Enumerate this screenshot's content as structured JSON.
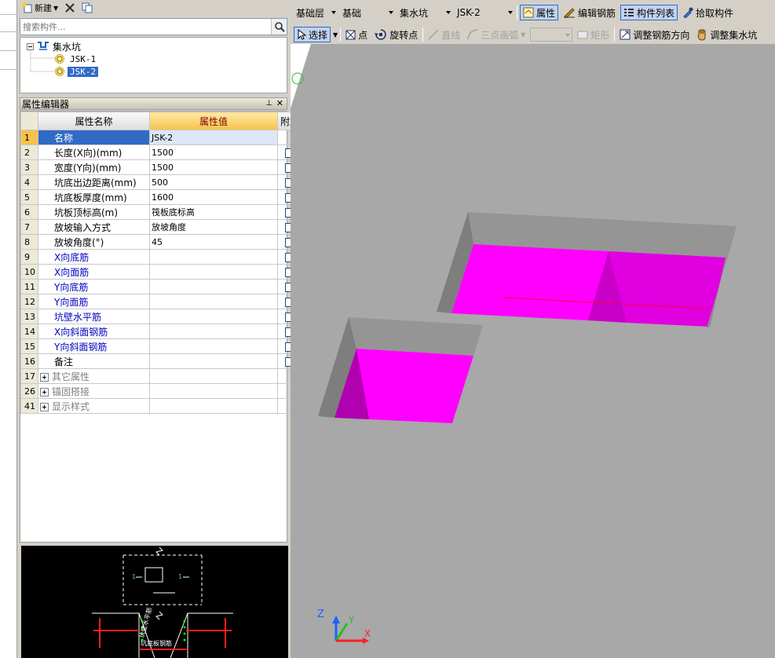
{
  "component_toolbar": {
    "new_label": "新建"
  },
  "search": {
    "placeholder": "搜索构件..."
  },
  "tree": {
    "root": "集水坑",
    "children": [
      {
        "label": "JSK-1",
        "selected": false
      },
      {
        "label": "JSK-2",
        "selected": true
      }
    ]
  },
  "property_editor": {
    "title": "属性编辑器",
    "columns": [
      "属性名称",
      "属性值",
      "附加"
    ],
    "rows": [
      {
        "num": "1",
        "name": "名称",
        "value": "JSK-2",
        "check": false,
        "style": "sel"
      },
      {
        "num": "2",
        "name": "长度(X向)(mm)",
        "value": "1500",
        "check": true,
        "style": ""
      },
      {
        "num": "3",
        "name": "宽度(Y向)(mm)",
        "value": "1500",
        "check": true,
        "style": ""
      },
      {
        "num": "4",
        "name": "坑底出边距离(mm)",
        "value": "500",
        "check": true,
        "style": ""
      },
      {
        "num": "5",
        "name": "坑底板厚度(mm)",
        "value": "1600",
        "check": true,
        "style": ""
      },
      {
        "num": "6",
        "name": "坑板顶标高(m)",
        "value": "筏板底标高",
        "check": true,
        "style": ""
      },
      {
        "num": "7",
        "name": "放坡输入方式",
        "value": "放坡角度",
        "check": true,
        "style": ""
      },
      {
        "num": "8",
        "name": "放坡角度(°)",
        "value": "45",
        "check": true,
        "style": ""
      },
      {
        "num": "9",
        "name": "X向底筋",
        "value": "",
        "check": true,
        "style": "blue"
      },
      {
        "num": "10",
        "name": "X向面筋",
        "value": "",
        "check": true,
        "style": "blue"
      },
      {
        "num": "11",
        "name": "Y向底筋",
        "value": "",
        "check": true,
        "style": "blue"
      },
      {
        "num": "12",
        "name": "Y向面筋",
        "value": "",
        "check": true,
        "style": "blue"
      },
      {
        "num": "13",
        "name": "坑壁水平筋",
        "value": "",
        "check": true,
        "style": "blue"
      },
      {
        "num": "14",
        "name": "X向斜面钢筋",
        "value": "",
        "check": true,
        "style": "blue"
      },
      {
        "num": "15",
        "name": "Y向斜面钢筋",
        "value": "",
        "check": true,
        "style": "blue"
      },
      {
        "num": "16",
        "name": "备注",
        "value": "",
        "check": true,
        "style": ""
      },
      {
        "num": "17",
        "name": "其它属性",
        "value": "",
        "check": false,
        "style": "grp"
      },
      {
        "num": "26",
        "name": "锚固搭接",
        "value": "",
        "check": false,
        "style": "grp"
      },
      {
        "num": "41",
        "name": "显示样式",
        "value": "",
        "check": false,
        "style": "grp"
      }
    ]
  },
  "top_toolbar": {
    "floor": "基础层",
    "category": "基础",
    "type": "集水坑",
    "component": "JSK-2",
    "properties_label": "属性",
    "edit_rebar_label": "编辑钢筋",
    "component_list_label": "构件列表",
    "pick_label": "拾取构件",
    "select_label": "选择",
    "point_label": "点",
    "rotate_point_label": "旋转点",
    "line_label": "直线",
    "arc_label": "三点画弧",
    "rect_label": "矩形",
    "adjust_rebar_dir_label": "调整钢筋方向",
    "adjust_pit_label": "调整集水坑"
  },
  "axes": {
    "x": "X",
    "y": "Y",
    "z": "Z"
  },
  "colors": {
    "pit_fill": "#ff00ff",
    "pit_wall": "#8c8c8c",
    "background": "#a8a8a8",
    "selection": "#316ac5"
  },
  "preview": {
    "dim_1": "1",
    "dim_2": "1",
    "label_1": "坑壁水平筋",
    "label_2": "坑底板钢筋"
  }
}
